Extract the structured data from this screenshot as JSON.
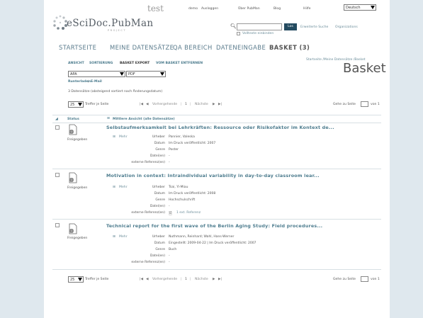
{
  "header": {
    "test_label": "test",
    "logo_text": "eSciDoc.PubMan",
    "logo_sub": "PROJECT",
    "top_links": [
      "demo",
      "Ausloggen",
      "Über PubMan",
      "Blog",
      "Hilfe"
    ],
    "language": "Deutsch",
    "search_button": "Los",
    "fulltext_label": "Volltexte einbinden",
    "advanced_search": "Erweiterte Suche",
    "organizations": "Organizations"
  },
  "nav": {
    "items": [
      "STARTSEITE",
      "MEINE DATENSÄTZE",
      "QA BEREICH",
      "DATENEINGABE",
      "BASKET (3)"
    ]
  },
  "subnav": {
    "items": [
      "ANSICHT",
      "SORTIERUNG",
      "BASKET EXPORT",
      "VOM BASKET ENTFERNEN"
    ]
  },
  "breadcrumb": "Startseite /Meine Datensätze /Basket",
  "page_title": "Basket",
  "export": {
    "format": "APA",
    "filetype": "PDF",
    "download": "Runterladen",
    "email": "E-Mail"
  },
  "summary": "3 Datensätze (absteigend sortiert nach Änderungsdatum)",
  "pagination": {
    "per_page": "25",
    "per_page_label": "Treffer je Seite",
    "prev": "Vorhergehende",
    "current": "1",
    "next": "Nächste",
    "goto_label": "Gehe zu Seite",
    "of_label": "von 1"
  },
  "table": {
    "status_header": "Status",
    "view_header": "Mittlere Ansicht (alle Datensätze)",
    "more_label": "Mehr",
    "field_labels": [
      "Urheber",
      "Datum",
      "Genre",
      "Datei(en)",
      "externe Referenz(en)"
    ],
    "rows": [
      {
        "status": "Freigegeben",
        "title": "Selbstaufmerksamkeit bei Lehrkräften: Ressource oder Risikofaktor im Kontext de...",
        "author": "Pannier, Valeska",
        "date": "Im Druck veröffentlicht: 2007",
        "genre": "Poster",
        "files": "-",
        "refs": "-"
      },
      {
        "status": "Freigegeben",
        "title": "Motivation in context: Intraindividual variability in day-to-day classroom lear...",
        "author": "Tsai, Yi-Miau",
        "date": "Im Druck veröffentlicht: 2008",
        "genre": "Hochschulschrift",
        "files": "-",
        "refs": "1 ext. Referenz"
      },
      {
        "status": "Freigegeben",
        "title": "Technical report for the first wave of the Berlin Aging Study: Field procedures...",
        "author": "Nuthmann, Reinhard; Wahl, Hans-Werner",
        "date": "Eingestellt: 2009-04-22 | Im Druck veröffentlicht: 2007",
        "genre": "Buch",
        "files": "-",
        "refs": "-"
      }
    ]
  }
}
